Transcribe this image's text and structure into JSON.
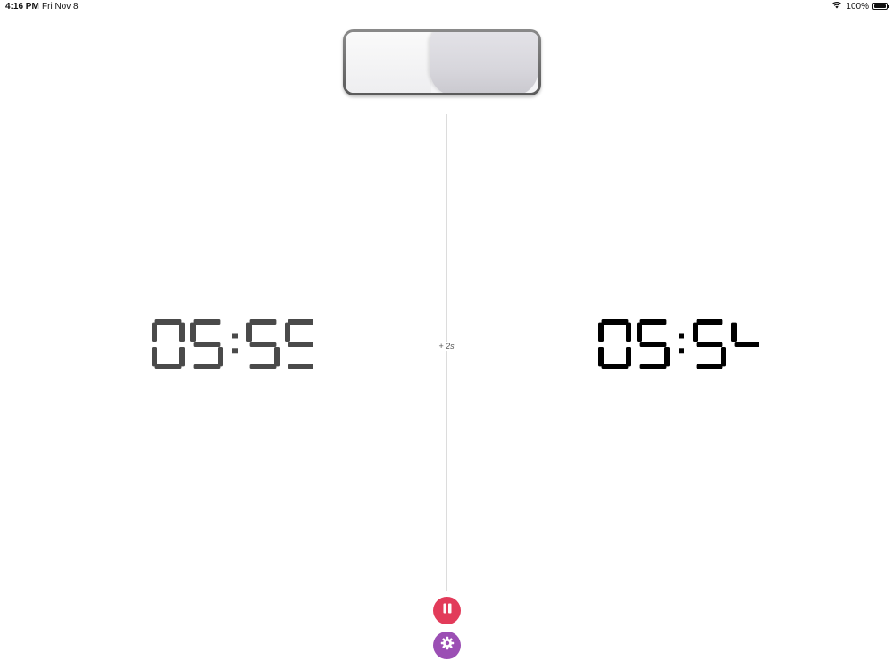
{
  "status_bar": {
    "time": "4:16 PM",
    "date": "Fri Nov 8",
    "battery": "100%",
    "battery_level": 1.0,
    "wifi_icon": "wifi-icon",
    "battery_icon": "battery-icon"
  },
  "increment": "+ 2s",
  "clocks": {
    "left": {
      "value": "05:55",
      "color": "#4a4a4a"
    },
    "right": {
      "value": "05:54",
      "color": "#000000"
    }
  },
  "buttons": {
    "pause": {
      "icon": "pause-icon",
      "color": "#e23b5a"
    },
    "settings": {
      "icon": "gear-icon",
      "color": "#9b4fb4"
    }
  }
}
